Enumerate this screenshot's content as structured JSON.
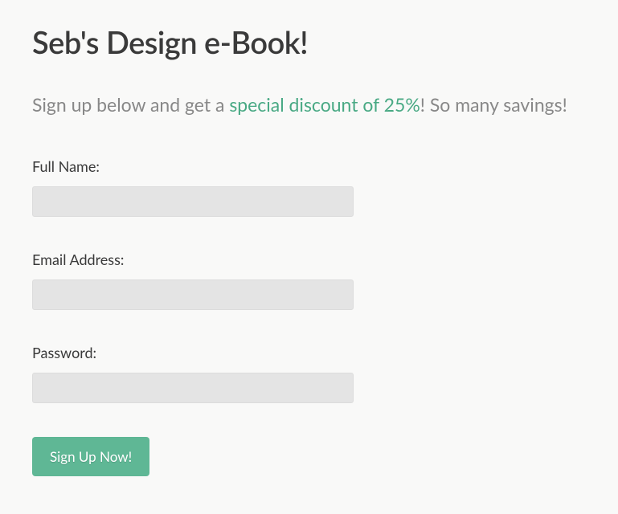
{
  "page": {
    "title": "Seb's Design e-Book!",
    "subtitle_prefix": "Sign up below and get a ",
    "subtitle_highlight": "special discount of 25%",
    "subtitle_suffix": "! So many savings!"
  },
  "form": {
    "fullname": {
      "label": "Full Name:",
      "value": ""
    },
    "email": {
      "label": "Email Address:",
      "value": ""
    },
    "password": {
      "label": "Password:",
      "value": ""
    },
    "submit_label": "Sign Up Now!"
  }
}
